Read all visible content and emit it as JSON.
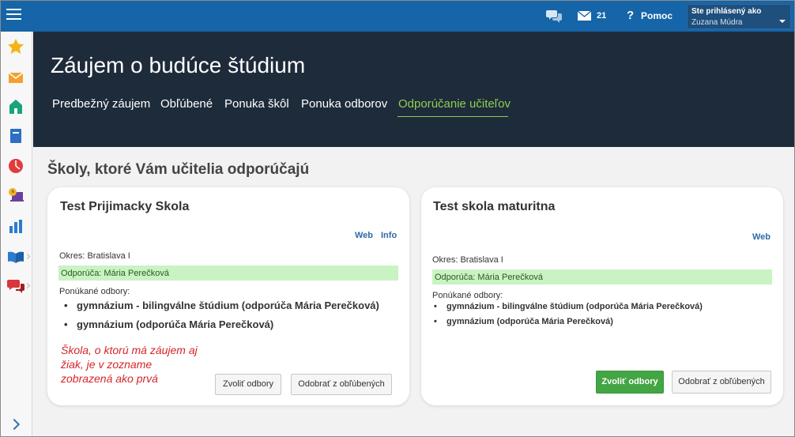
{
  "topbar": {
    "mail_count": "21",
    "help_label": "Pomoc",
    "user_caption": "Ste prihlásený ako",
    "user_name": "Zuzana Múdra"
  },
  "sidebar": {
    "icons": [
      "star-icon",
      "mail-icon",
      "school-icon",
      "book-icon",
      "chart-pie-icon",
      "laptop-clock-icon",
      "bar-chart-icon",
      "open-book-icon",
      "chat-icon"
    ]
  },
  "header": {
    "title": "Záujem o budúce štúdium",
    "tabs": [
      "Predbežný záujem",
      "Obľúbené",
      "Ponuka škôl",
      "Ponuka odborov",
      "Odporúčanie učiteľov"
    ],
    "active_tab": "Odporúčanie učiteľov"
  },
  "main": {
    "section_title": "Školy, ktoré Vám učitelia odporúčajú",
    "cards": [
      {
        "title": "Test Prijimacky Skola",
        "links": [
          "Web",
          "Info"
        ],
        "district": "Okres: Bratislava I",
        "recommended_by": "Odporúča: Mária Perečková",
        "fields_label": "Ponúkané odbory:",
        "fields": [
          "gymnázium - bilingválne štúdium (odporúča Mária Perečková)",
          "gymnázium (odporúča Mária Perečková)"
        ],
        "note": "Škola, o ktorú má záujem aj žiak, je v zozname zobrazená ako prvá",
        "buttons": [
          "Zvoliť odbory",
          "Odobrať z obľúbených"
        ]
      },
      {
        "title": "Test skola maturitna",
        "links": [
          "Web"
        ],
        "district": "Okres: Bratislava I",
        "recommended_by": "Odporúča: Mária Perečková",
        "fields_label": "Ponúkané odbory:",
        "fields": [
          "gymnázium - bilingválne štúdium (odporúča Mária Perečková)",
          "gymnázium (odporúča Mária Perečková)"
        ],
        "buttons": [
          "Zvoliť odbory",
          "Odobrať z obľúbených"
        ]
      }
    ]
  },
  "colors": {
    "topbar": "#1565a8",
    "header": "#1e2b3b",
    "active_tab": "#8dcf4f",
    "recommendation_bg": "#c9f3c3",
    "primary_button": "#43a543",
    "note_text": "#d6262a"
  }
}
